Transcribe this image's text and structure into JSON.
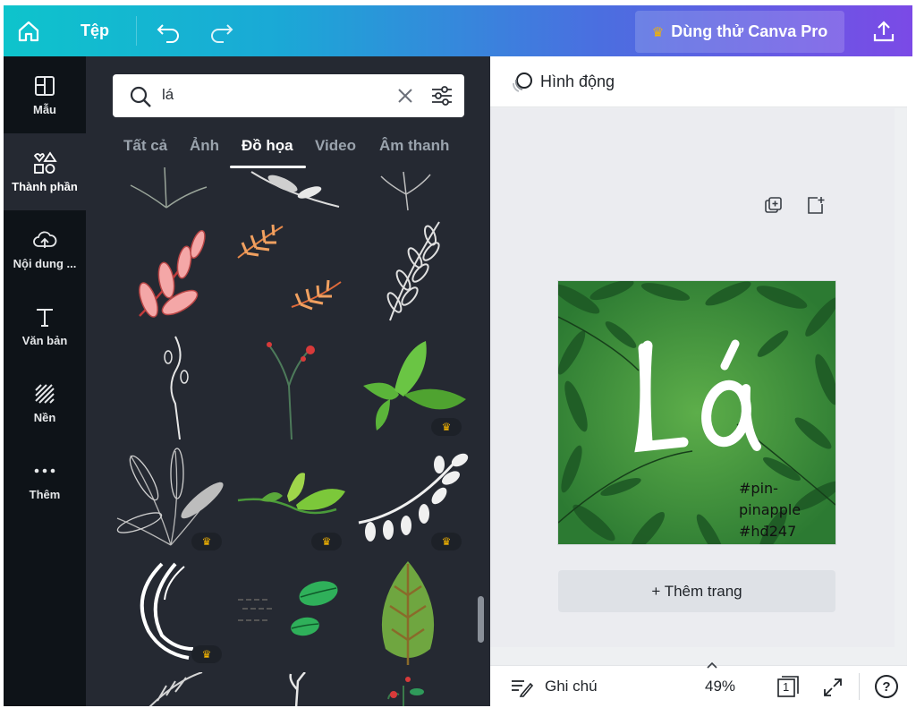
{
  "topbar": {
    "file_label": "Tệp",
    "pro_label": "Dùng thử Canva Pro"
  },
  "rail": {
    "items": [
      {
        "label": "Mẫu",
        "icon": "template-icon"
      },
      {
        "label": "Thành phần",
        "icon": "elements-icon"
      },
      {
        "label": "Nội dung ...",
        "icon": "upload-cloud-icon"
      },
      {
        "label": "Văn bản",
        "icon": "text-icon"
      },
      {
        "label": "Nền",
        "icon": "background-icon"
      },
      {
        "label": "Thêm",
        "icon": "more-icon"
      }
    ]
  },
  "search": {
    "value": "lá"
  },
  "tabs": [
    "Tất cả",
    "Ảnh",
    "Đồ họa",
    "Video",
    "Âm thanh"
  ],
  "active_tab": "Đồ họa",
  "canvas": {
    "title_text": "Lá",
    "hashtag_1": "#pin-pinapple",
    "hashtag_2": "#hđ247"
  },
  "editor": {
    "animate_label": "Hình động",
    "add_page_label": "+ Thêm trang",
    "notes_label": "Ghi chú",
    "zoom": "49%",
    "page_count": "1",
    "help_label": "?"
  },
  "colors": {
    "accent_start": "#0ec4cc",
    "accent_end": "#7b4ae6",
    "panel_bg": "#252932",
    "rail_bg": "#0e1318",
    "pro_crown": "#f4b400"
  }
}
